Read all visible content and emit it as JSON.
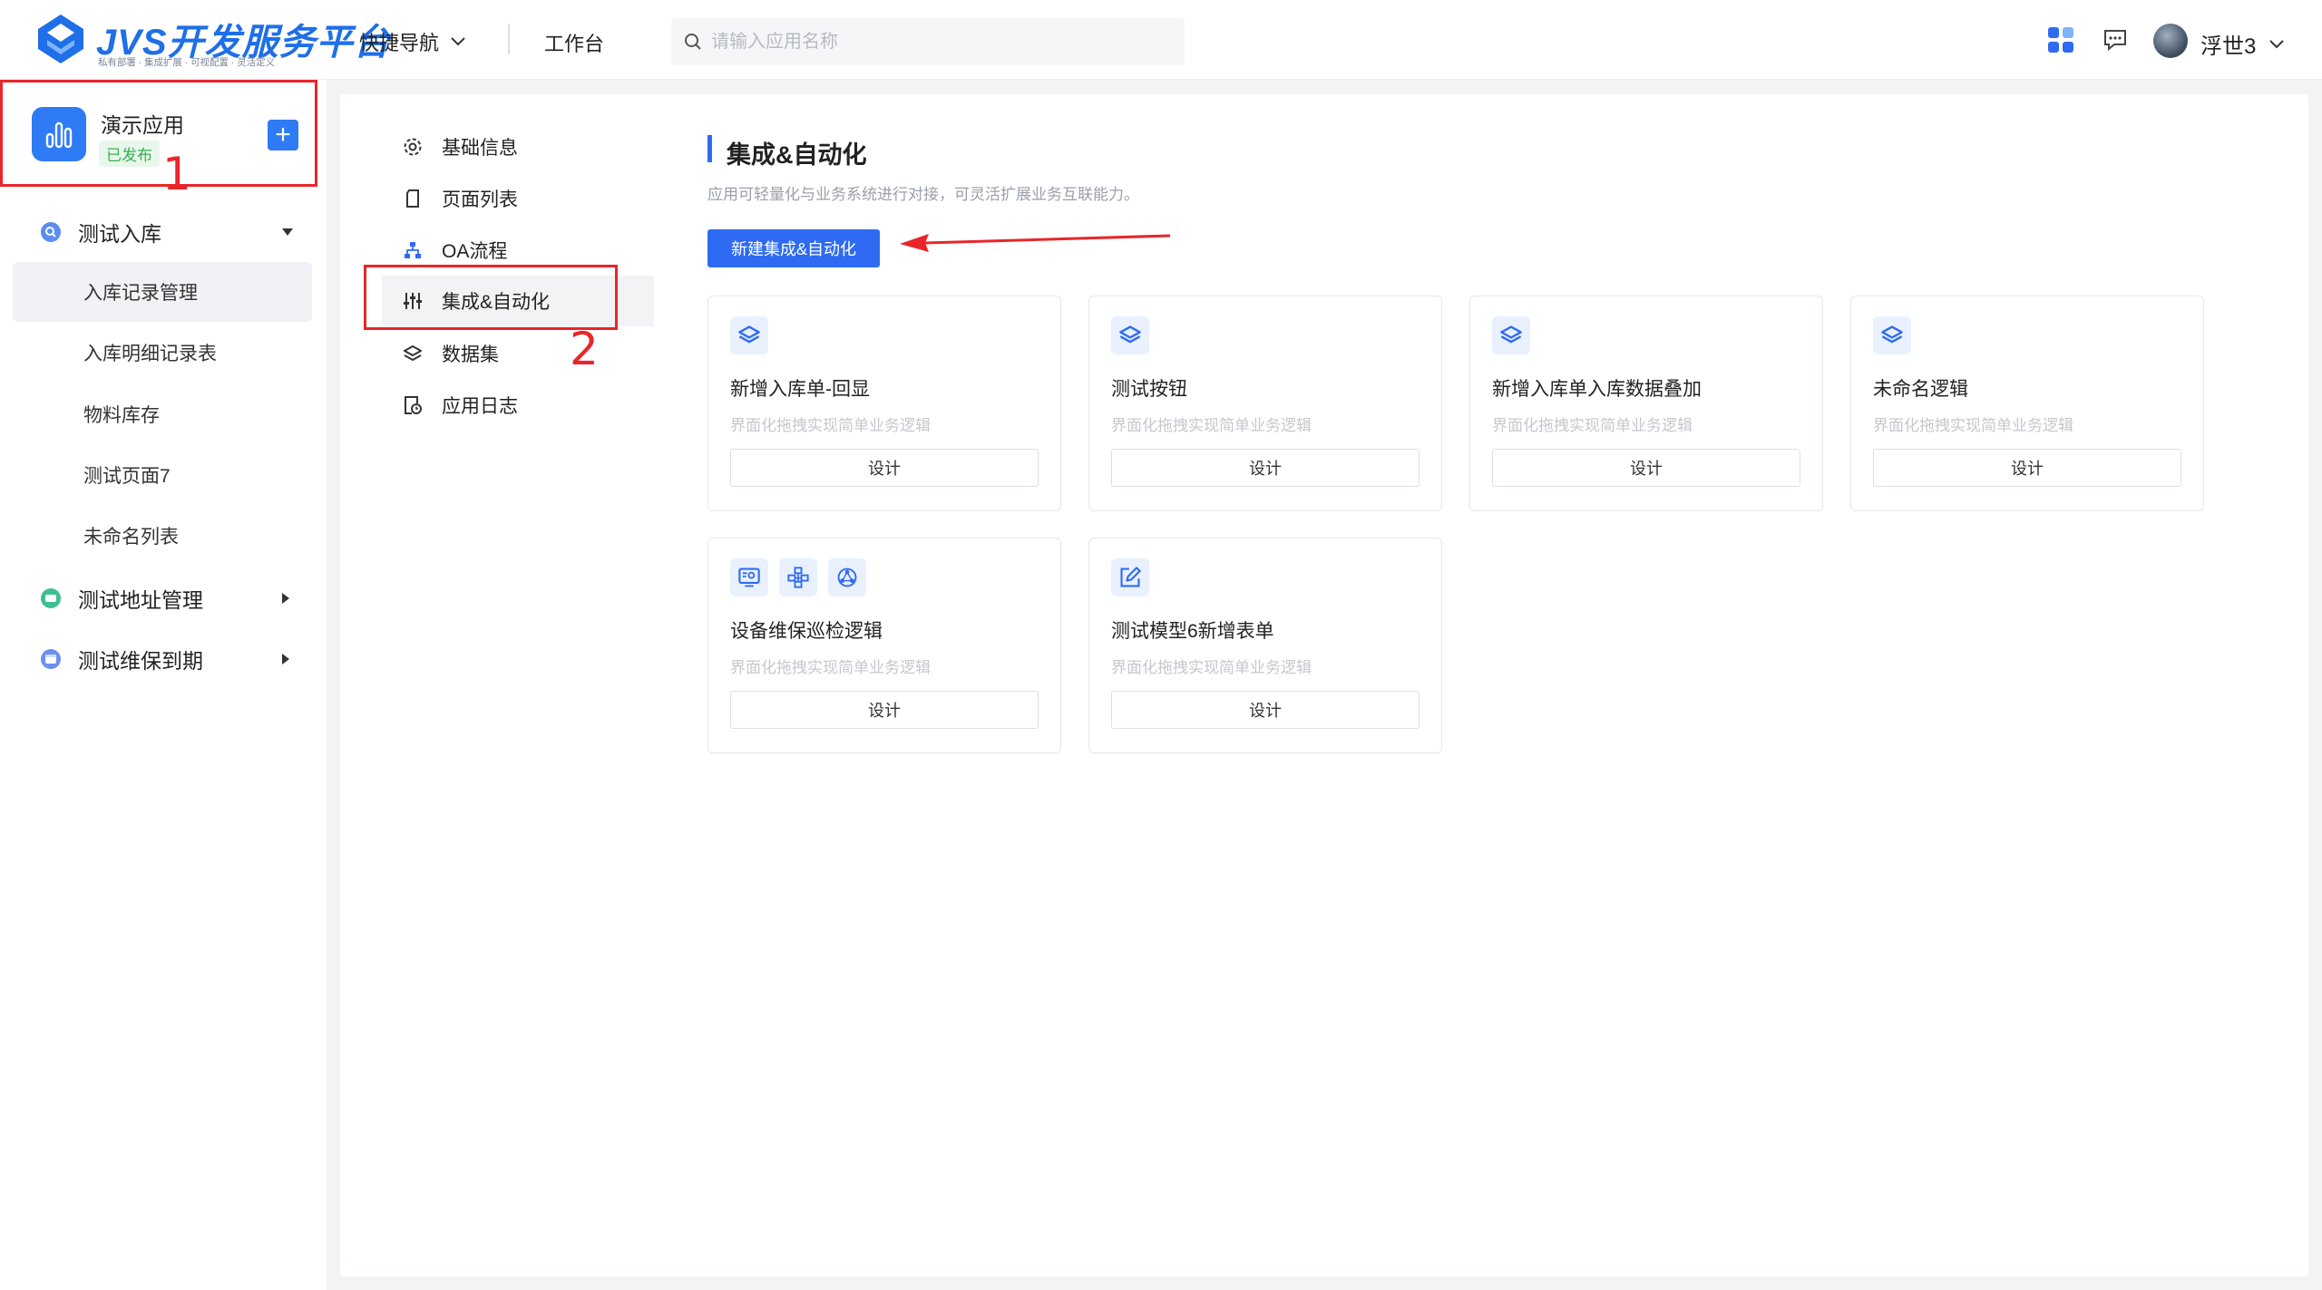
{
  "brand": {
    "title": "JVS开发服务平台",
    "subtitle": "私有部署 · 集成扩展 · 可视配置 · 灵活定义",
    "color": "#1e6fe8"
  },
  "topnav": {
    "quick_nav": "快捷导航",
    "workbench": "工作台",
    "search_placeholder": "请输入应用名称",
    "user_name": "浮世3"
  },
  "app": {
    "name": "演示应用",
    "status": "已发布"
  },
  "annotations": {
    "one": "1",
    "two": "2",
    "color": "#e8262a"
  },
  "sidebar": {
    "groups": [
      {
        "label": "测试入库",
        "expanded": true,
        "icon": "search-circle-icon",
        "items": [
          "入库记录管理",
          "入库明细记录表",
          "物料库存",
          "测试页面7",
          "未命名列表"
        ]
      },
      {
        "label": "测试地址管理",
        "expanded": false,
        "icon": "map-circle-icon"
      },
      {
        "label": "测试维保到期",
        "expanded": false,
        "icon": "calendar-circle-icon"
      }
    ],
    "active_item": "入库记录管理"
  },
  "subnav": {
    "items": [
      "基础信息",
      "页面列表",
      "OA流程",
      "集成&自动化",
      "数据集",
      "应用日志"
    ],
    "active": "集成&自动化"
  },
  "section": {
    "title": "集成&自动化",
    "description": "应用可轻量化与业务系统进行对接，可灵活扩展业务互联能力。",
    "new_button": "新建集成&自动化",
    "accent": "#2f6bf2"
  },
  "cards": [
    {
      "title": "新增入库单-回显",
      "desc": "界面化拖拽实现简单业务逻辑",
      "button": "设计"
    },
    {
      "title": "测试按钮",
      "desc": "界面化拖拽实现简单业务逻辑",
      "button": "设计"
    },
    {
      "title": "新增入库单入库数据叠加",
      "desc": "界面化拖拽实现简单业务逻辑",
      "button": "设计"
    },
    {
      "title": "未命名逻辑",
      "desc": "界面化拖拽实现简单业务逻辑",
      "button": "设计"
    },
    {
      "title": "设备维保巡检逻辑",
      "desc": "界面化拖拽实现简单业务逻辑",
      "button": "设计"
    },
    {
      "title": "测试模型6新增表单",
      "desc": "界面化拖拽实现简单业务逻辑",
      "button": "设计"
    }
  ]
}
